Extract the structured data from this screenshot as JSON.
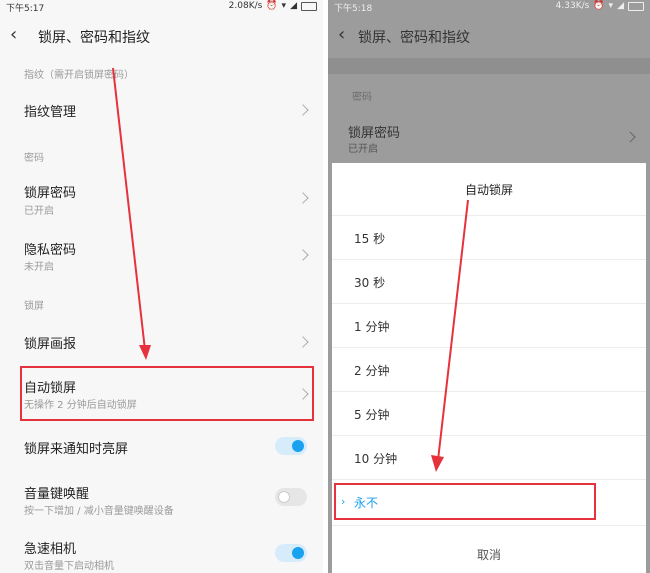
{
  "left": {
    "status": {
      "time": "下午5:17",
      "speed": "2.08K/s"
    },
    "header": {
      "title": "锁屏、密码和指纹"
    },
    "sections": {
      "fingerprint": "指纹（需开启锁屏密码）",
      "password": "密码",
      "lock": "锁屏"
    },
    "items": {
      "fingerprint_manage": {
        "title": "指纹管理"
      },
      "lock_password": {
        "title": "锁屏密码",
        "sub": "已开启"
      },
      "privacy_password": {
        "title": "隐私密码",
        "sub": "未开启"
      },
      "lock_wallpaper": {
        "title": "锁屏画报"
      },
      "auto_lock": {
        "title": "自动锁屏",
        "sub": "无操作 2 分钟后自动锁屏"
      },
      "notify_wake": {
        "title": "锁屏来通知时亮屏",
        "state": "on"
      },
      "volume_wake": {
        "title": "音量键唤醒",
        "sub": "按一下增加 / 减小音量键唤醒设备",
        "state": "off"
      },
      "quick_camera": {
        "title": "急速相机",
        "sub": "双击音量下启动相机",
        "state": "on"
      }
    }
  },
  "right": {
    "status": {
      "time": "下午5:18",
      "speed": "4.33K/s"
    },
    "header": {
      "title": "锁屏、密码和指纹"
    },
    "section": "密码",
    "bg_item": {
      "title": "锁屏密码",
      "sub": "已开启"
    },
    "dialog": {
      "title": "自动锁屏",
      "options": [
        "15 秒",
        "30 秒",
        "1 分钟",
        "2 分钟",
        "5 分钟",
        "10 分钟",
        "永不"
      ],
      "selected": "永不",
      "cancel": "取消"
    }
  },
  "colors": {
    "accent": "#1aa1ef",
    "highlight": "#e5323c"
  }
}
